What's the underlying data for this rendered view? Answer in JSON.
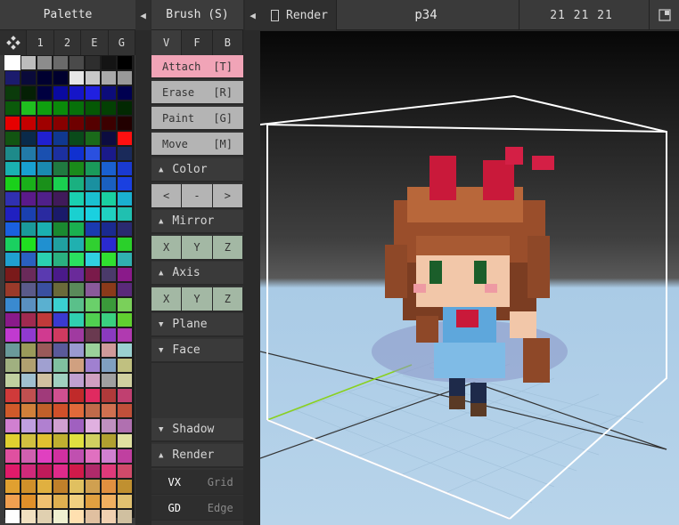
{
  "palette": {
    "title": "Palette",
    "tabs": [
      "1",
      "2",
      "E",
      "G"
    ],
    "colors": [
      [
        "#ffffff",
        "#bdbdbd",
        "#8c8c8c",
        "#6a6a6a",
        "#4a4a4a",
        "#2e2e2e",
        "#141414",
        "#000000"
      ],
      [
        "#1b1b6d",
        "#0a0a3a",
        "#000030",
        "#00002e",
        "#e6e6e6",
        "#c8c8c8",
        "#a9a9a9",
        "#999999"
      ],
      [
        "#0b3b0b",
        "#052005",
        "#000040",
        "#0a0aa0",
        "#1515c8",
        "#2020e0",
        "#0c0c7a",
        "#000050"
      ],
      [
        "#0b5a0b",
        "#1fbf1f",
        "#0f9f0f",
        "#0a8a0a",
        "#07700a",
        "#055805",
        "#034003",
        "#022802"
      ],
      [
        "#e60000",
        "#c40000",
        "#a00000",
        "#880000",
        "#6e0000",
        "#550000",
        "#3c0000",
        "#220000"
      ],
      [
        "#125412",
        "#0a2a4a",
        "#2020d0",
        "#103890",
        "#0a4a1a",
        "#1a6a1a",
        "#0c0c40",
        "#ff1010"
      ],
      [
        "#1e8a8a",
        "#227aa8",
        "#1a50b0",
        "#1c30a0",
        "#1030d0",
        "#2a50e0",
        "#1a1a8a",
        "#1a2a5a"
      ],
      [
        "#1ab0b0",
        "#18a0d0",
        "#1a8ab0",
        "#207a40",
        "#1a8a1a",
        "#1a9a5a",
        "#1a60d0",
        "#1a3ad0"
      ],
      [
        "#1ad01a",
        "#1ab01a",
        "#1a901a",
        "#1ad050",
        "#1ab080",
        "#1a90a0",
        "#1a60c0",
        "#1a40e0"
      ],
      [
        "#3030b0",
        "#5a1a8a",
        "#50208a",
        "#401a5a",
        "#1ad0b0",
        "#1ac0d0",
        "#1ad0a0",
        "#1ab0d0"
      ],
      [
        "#2020c0",
        "#1a40b0",
        "#2a2aa0",
        "#1a1a6a",
        "#1ad0d0",
        "#1ad0e0",
        "#20d0c0",
        "#20c0b0"
      ],
      [
        "#1a60e0",
        "#1a9a9a",
        "#1ab0b0",
        "#1a8a30",
        "#1ab050",
        "#1a3ab0",
        "#1a2a90",
        "#2a2a70"
      ],
      [
        "#1ad060",
        "#20e020",
        "#2090d0",
        "#20a0a0",
        "#20b0b0",
        "#30d030",
        "#2a2ad0",
        "#2ad02a"
      ],
      [
        "#20a0d0",
        "#2a60c0",
        "#2ad0b0",
        "#2ab080",
        "#2ae060",
        "#30d0e0",
        "#30e030",
        "#30b0b0"
      ],
      [
        "#7a1a1a",
        "#6a2a5a",
        "#5a3ab0",
        "#4a1a8a",
        "#6a2a9a",
        "#7a1a4a",
        "#4a3a6a",
        "#8a1a8a"
      ],
      [
        "#9a3a2a",
        "#5a5a8a",
        "#3a50a0",
        "#6a6a3a",
        "#5a8a5a",
        "#8a5a9a",
        "#8a3a1a",
        "#5a2a7a"
      ],
      [
        "#3a8ad0",
        "#5a90c0",
        "#5ab0d0",
        "#3ad0d0",
        "#5ac08a",
        "#6ad06a",
        "#3a9a3a",
        "#7ad05a"
      ],
      [
        "#8a1a8a",
        "#a02a50",
        "#c03a3a",
        "#3a3ad0",
        "#30d0b0",
        "#50d050",
        "#3ad080",
        "#60d030"
      ],
      [
        "#c03ad0",
        "#903ad0",
        "#d03a90",
        "#d03a60",
        "#a03aa0",
        "#6a3a50",
        "#8a3ac0",
        "#b03ab0"
      ],
      [
        "#6a9a9a",
        "#9a9a5a",
        "#9a5a5a",
        "#5a5a9a",
        "#9a9ad0",
        "#9ad09a",
        "#d09a9a",
        "#9ad0d0"
      ],
      [
        "#a0b080",
        "#b0a070",
        "#a0a0d0",
        "#80c0a0",
        "#d0a080",
        "#a080d0",
        "#80a0c0",
        "#c0c080"
      ],
      [
        "#c0d0a0",
        "#a0c0d0",
        "#d0c0a0",
        "#a0d0c0",
        "#c0a0d0",
        "#d0a0c0",
        "#a0a0a0",
        "#d0d0a0"
      ],
      [
        "#d03a3a",
        "#c05050",
        "#a03a7a",
        "#d05090",
        "#c02a2a",
        "#e02a60",
        "#b03a3a",
        "#c04070"
      ],
      [
        "#d05a2a",
        "#d0803a",
        "#c0602a",
        "#d0502a",
        "#e06a3a",
        "#c06a4a",
        "#d07050",
        "#c0503a"
      ],
      [
        "#d080d0",
        "#c0a0e0",
        "#b080d0",
        "#d0a0d0",
        "#a060c0",
        "#e0b0e0",
        "#c090c0",
        "#b070b0"
      ],
      [
        "#e0d030",
        "#d0c040",
        "#e0c030",
        "#c0b030",
        "#e0e040",
        "#d0d060",
        "#b0a030",
        "#e0e0a0"
      ],
      [
        "#e050a0",
        "#d060b0",
        "#e040c0",
        "#d030a0",
        "#c050b0",
        "#e070c0",
        "#d080d0",
        "#c040a0"
      ],
      [
        "#e01a6a",
        "#d02a7a",
        "#c01a5a",
        "#e02a8a",
        "#d01a4a",
        "#b02a6a",
        "#e03a7a",
        "#d04a6a"
      ],
      [
        "#e0a030",
        "#d0902a",
        "#e0b040",
        "#c0802a",
        "#e0c060",
        "#d0a050",
        "#e09040",
        "#c09030"
      ],
      [
        "#f0a050",
        "#e0902a",
        "#f0c070",
        "#e0b050",
        "#f0d080",
        "#e0a040",
        "#f0b060",
        "#e0c070"
      ],
      [
        "#ffffff",
        "#f0e0c0",
        "#e0d0b0",
        "#f0f0d0",
        "#ffe0b0",
        "#e0c0a0",
        "#f0d0b0",
        "#d0c0a0"
      ]
    ]
  },
  "brush": {
    "title": "Brush (S)",
    "tabs": [
      "V",
      "F",
      "B"
    ],
    "tools": [
      {
        "label": "Attach",
        "key": "[T]",
        "active": true
      },
      {
        "label": "Erase",
        "key": "[R]",
        "active": false
      },
      {
        "label": "Paint",
        "key": "[G]",
        "active": false
      },
      {
        "label": "Move",
        "key": "[M]",
        "active": false
      }
    ],
    "color_section": "Color",
    "color_buttons": [
      "<",
      "-",
      ">"
    ],
    "mirror_section": "Mirror",
    "mirror_buttons": [
      "X",
      "Y",
      "Z"
    ],
    "axis_section": "Axis",
    "axis_buttons": [
      "X",
      "Y",
      "Z"
    ],
    "plane_section": "Plane",
    "face_section": "Face",
    "shadow_section": "Shadow",
    "render_section": "Render",
    "render_toggles": [
      {
        "label": "VX",
        "on": true
      },
      {
        "label": "Grid",
        "on": false
      },
      {
        "label": "GD",
        "on": true
      },
      {
        "label": "Edge",
        "on": false
      }
    ]
  },
  "viewport": {
    "render_label": "Render",
    "file_name": "p34",
    "dimensions": "21 21 21"
  }
}
